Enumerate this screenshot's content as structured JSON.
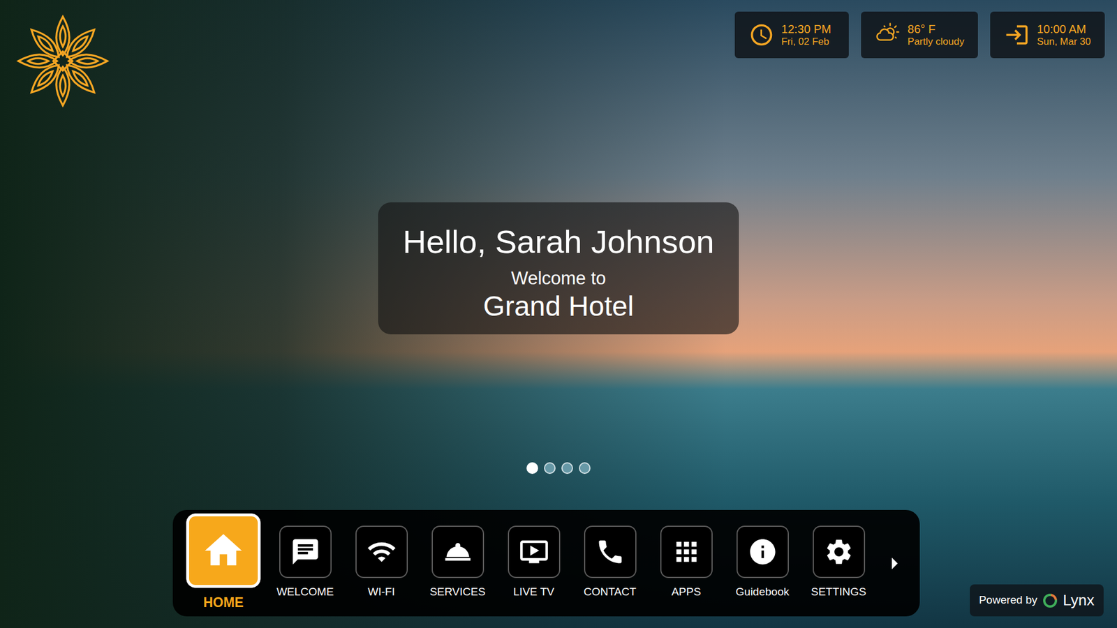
{
  "widgets": [
    {
      "primary": "12:30 PM",
      "secondary": "Fri, 02 Feb"
    },
    {
      "primary": "86° F",
      "secondary": "Partly cloudy"
    },
    {
      "primary": "10:00 AM",
      "secondary": "Sun, Mar 30"
    }
  ],
  "greeting": {
    "title": "Hello, Sarah Johnson",
    "subtitle": "Welcome to",
    "hotel": "Grand Hotel"
  },
  "carousel": {
    "dots": [
      {
        "selected": true
      },
      {
        "selected": false
      },
      {
        "selected": false
      },
      {
        "selected": false
      }
    ]
  },
  "nav": {
    "items": [
      {
        "label": "HOME",
        "selected": true
      },
      {
        "label": "WELCOME",
        "selected": false
      },
      {
        "label": "WI-FI",
        "selected": false
      },
      {
        "label": "SERVICES",
        "selected": false
      },
      {
        "label": "LIVE TV",
        "selected": false
      },
      {
        "label": "CONTACT",
        "selected": false
      },
      {
        "label": "APPS",
        "selected": false
      },
      {
        "label": "Guidebook",
        "selected": false
      },
      {
        "label": "SETTINGS",
        "selected": false
      }
    ]
  },
  "footer": {
    "powered_by": "Powered by",
    "brand": "Lynx"
  }
}
